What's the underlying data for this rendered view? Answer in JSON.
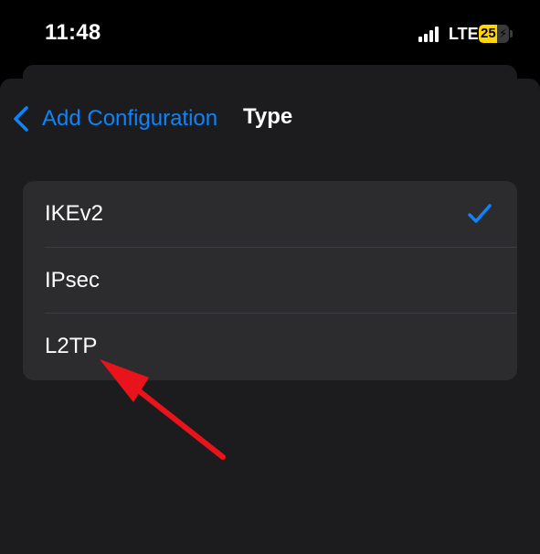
{
  "status_bar": {
    "time": "11:48",
    "carrier": "LTE",
    "battery_level": "25",
    "battery_percent": 25,
    "battery_color": "#ffd60a",
    "charging_icon": "bolt-icon"
  },
  "nav": {
    "back_label": "Add Configuration",
    "back_icon": "chevron-left-icon",
    "title": "Type"
  },
  "type_options": [
    {
      "label": "IKEv2",
      "selected": true
    },
    {
      "label": "IPsec",
      "selected": false
    },
    {
      "label": "L2TP",
      "selected": false
    }
  ],
  "colors": {
    "accent": "#0a84ff",
    "annotation_arrow": "#e8131b"
  }
}
